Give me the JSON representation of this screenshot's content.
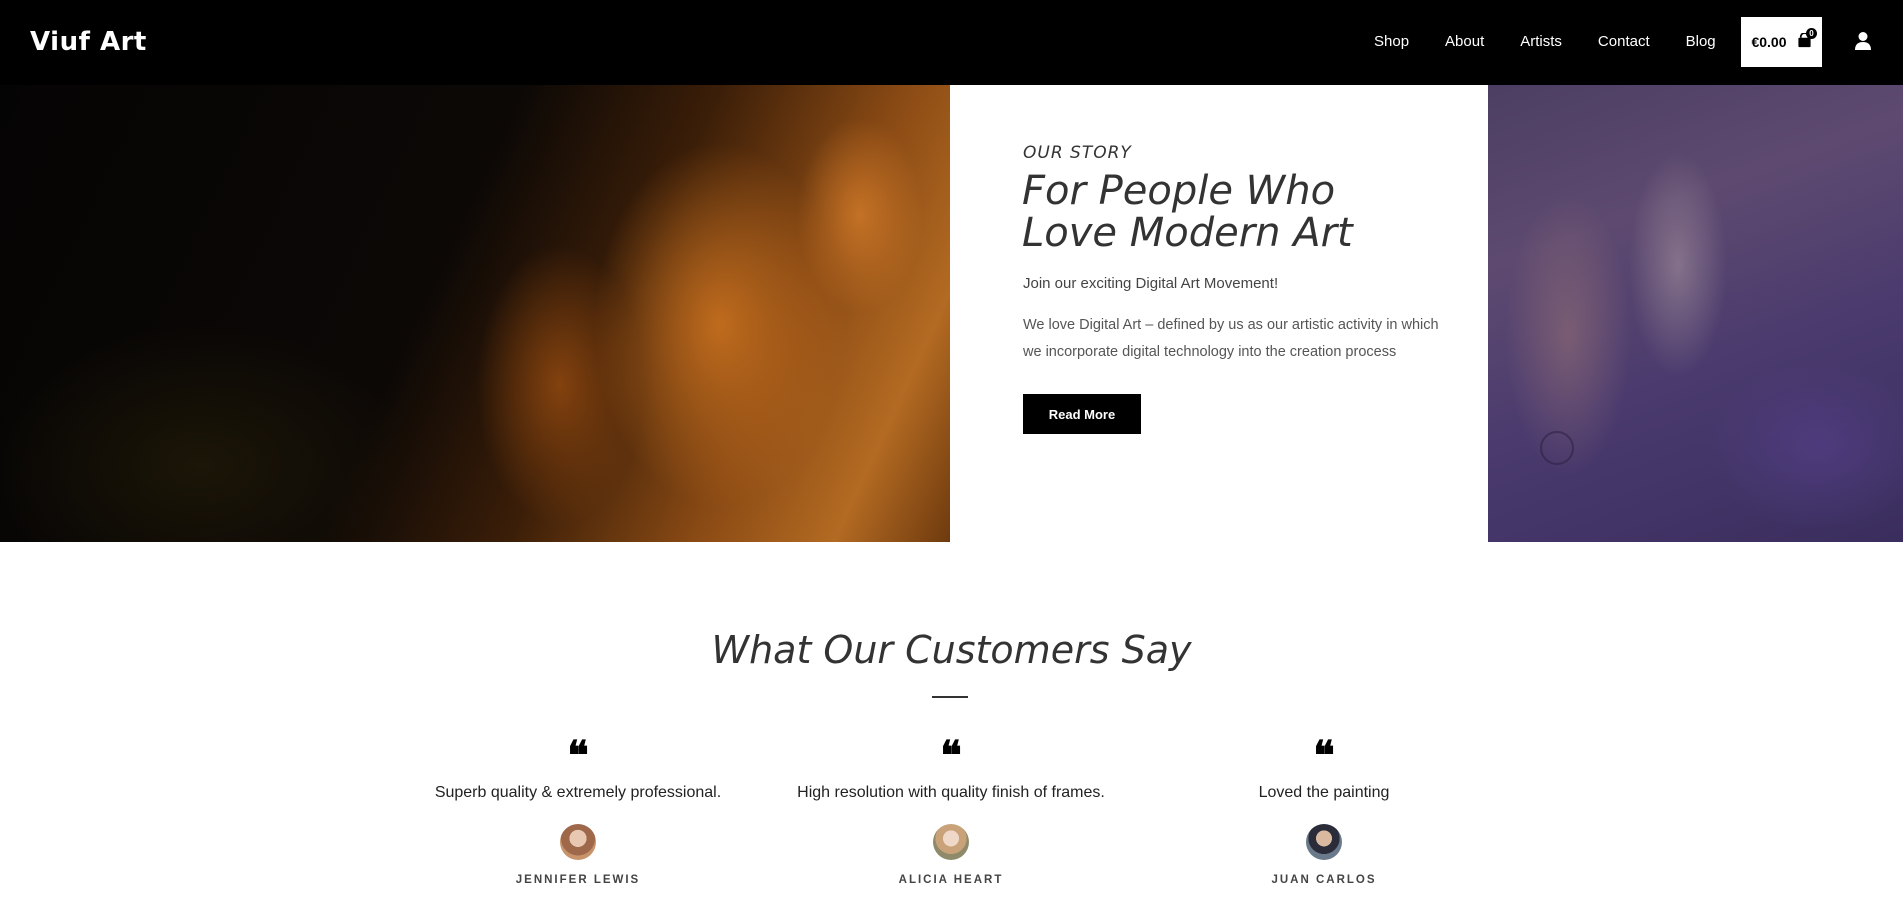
{
  "brand": {
    "logo_text": "Viuf Art"
  },
  "nav": {
    "items": [
      {
        "label": "Shop"
      },
      {
        "label": "About"
      },
      {
        "label": "Artists"
      },
      {
        "label": "Contact"
      },
      {
        "label": "Blog"
      }
    ],
    "cart": {
      "total": "€0.00",
      "count": "0",
      "icon": "shopping-bag-icon"
    },
    "account_icon": "user-icon"
  },
  "story": {
    "eyebrow": "OUR STORY",
    "title": "For People Who Love Modern Art",
    "lead": "Join our exciting Digital Art Movement!",
    "body": "We love Digital Art – defined by us as our artistic activity in which we incorporate digital technology into the creation process",
    "button_label": "Read More"
  },
  "testimonials": {
    "title": "What Our Customers Say",
    "items": [
      {
        "quote": "Superb quality & extremely professional.",
        "author": "JENNIFER LEWIS"
      },
      {
        "quote": "High resolution with quality finish of frames.",
        "author": "ALICIA HEART"
      },
      {
        "quote": "Loved the painting",
        "author": "JUAN CARLOS"
      }
    ]
  },
  "colors": {
    "header_bg": "#000000",
    "button_bg": "#000000",
    "accent_left_art": "#b36a22",
    "accent_right_art": "#4a3a6e"
  }
}
